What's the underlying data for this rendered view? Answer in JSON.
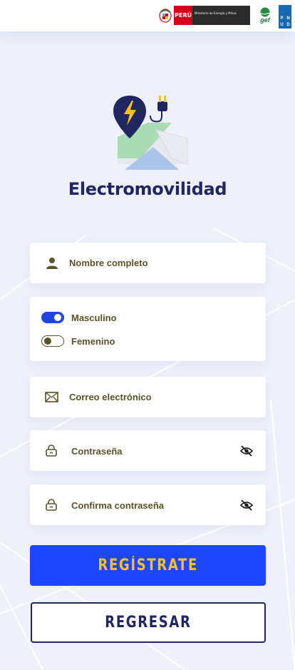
{
  "header": {
    "peru_label": "PERÚ",
    "ministry_label": "Ministerio de Energía y Minas",
    "gef_label": "gef",
    "undp_letters": [
      "P",
      "N",
      "U",
      "D"
    ]
  },
  "brand": {
    "title": "Electromovilidad"
  },
  "form": {
    "full_name_placeholder": "Nombre completo",
    "gender": {
      "options": [
        {
          "label": "Masculino",
          "selected": true
        },
        {
          "label": "Femenino",
          "selected": false
        }
      ]
    },
    "email_placeholder": "Correo electrónico",
    "password_placeholder": "Contraseña",
    "confirm_password_placeholder": "Confirma contraseña"
  },
  "actions": {
    "register_label": "REGÍSTRATE",
    "back_label": "REGRESAR"
  },
  "colors": {
    "primary": "#1f46ff",
    "accent_yellow": "#f5c02a",
    "navy": "#1f2660",
    "label_olive": "#5a5228",
    "background": "#eef0fa"
  }
}
